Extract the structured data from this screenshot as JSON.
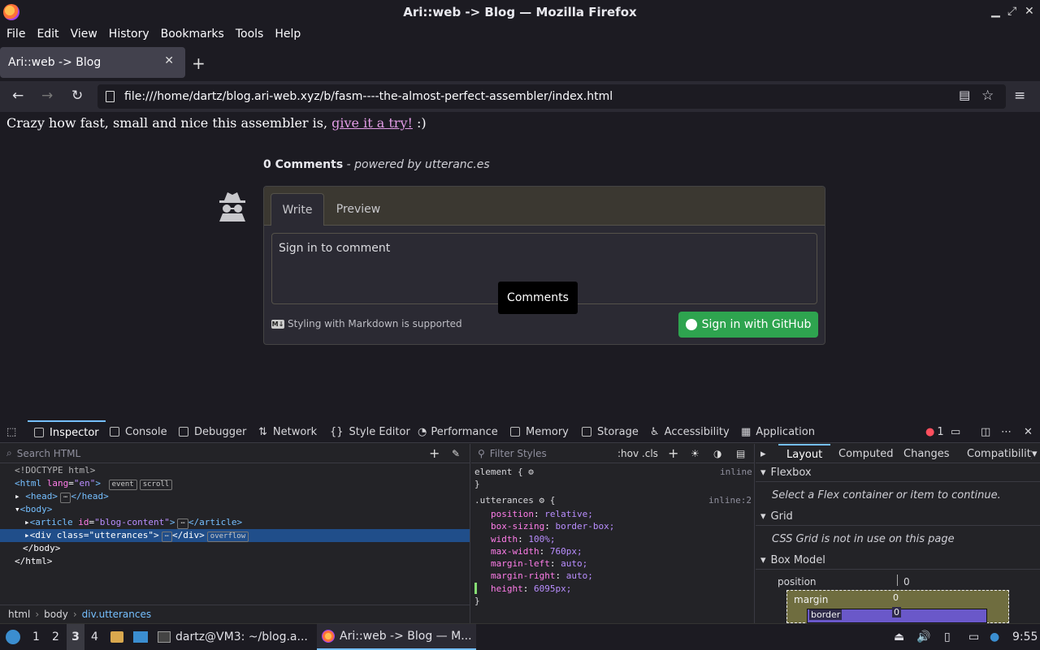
{
  "window": {
    "title": "Ari::web -> Blog — Mozilla Firefox"
  },
  "menubar": [
    "File",
    "Edit",
    "View",
    "History",
    "Bookmarks",
    "Tools",
    "Help"
  ],
  "tab": {
    "title": "Ari::web -> Blog"
  },
  "urlbar": {
    "url": "file:///home/dartz/blog.ari-web.xyz/b/fasm----the-almost-perfect-assembler/index.html"
  },
  "page": {
    "intro_text": "Crazy how fast, small and nice this assembler is,",
    "intro_link": "give it a try!",
    "intro_suffix": ":)",
    "comments_count": "0 Comments",
    "powered_by": "- powered by utteranc.es",
    "tabs": [
      "Write",
      "Preview"
    ],
    "textarea_text": "Sign in to comment",
    "markdown_note": "Styling with Markdown is supported",
    "markdown_icon": "M↓",
    "signin_button": "Sign in with GitHub",
    "tooltip": "Comments"
  },
  "devtools": {
    "tabs": [
      "Inspector",
      "Console",
      "Debugger",
      "Network",
      "Style Editor",
      "Performance",
      "Memory",
      "Storage",
      "Accessibility",
      "Application"
    ],
    "error_count": "1",
    "search_placeholder": "Search HTML",
    "filter_placeholder": "Filter Styles",
    "hov_cls": ":hov .cls",
    "tree": {
      "doctype": "<!DOCTYPE html>",
      "html_open": "<html",
      "html_attr": "lang",
      "html_val": "\"en\"",
      "pill_event": "event",
      "pill_scroll": "scroll",
      "head": "<head>",
      "head_close": "</head>",
      "body": "<body>",
      "article_open": "<article",
      "article_attr": "id",
      "article_val": "\"blog-content\"",
      "article_close": "</article>",
      "div_open": "<div",
      "div_attr": "class",
      "div_val": "\"utterances\"",
      "div_close": "</div>",
      "pill_overflow": "overflow",
      "body_close": "</body>",
      "html_close": "</html>"
    },
    "breadcrumbs": [
      "html",
      "body",
      "div.utterances"
    ],
    "rules": {
      "element_selector": "element {",
      "element_src": "inline",
      "close": "}",
      "utterances_selector": ".utterances",
      "utterances_src": "inline:2",
      "declarations": [
        {
          "prop": "position",
          "val": "relative;"
        },
        {
          "prop": "box-sizing",
          "val": "border-box;"
        },
        {
          "prop": "width",
          "val": "100%;"
        },
        {
          "prop": "max-width",
          "val": "760px;"
        },
        {
          "prop": "margin-left",
          "val": "auto;"
        },
        {
          "prop": "margin-right",
          "val": "auto;"
        },
        {
          "prop": "height",
          "val": "6095px;"
        }
      ]
    },
    "layout_tabs": [
      "Layout",
      "Computed",
      "Changes",
      "Compatibility"
    ],
    "sections": {
      "flexbox": "Flexbox",
      "flexbox_msg": "Select a Flex container or item to continue.",
      "grid": "Grid",
      "grid_msg": "CSS Grid is not in use on this page",
      "boxmodel": "Box Model"
    },
    "boxmodel": {
      "position_label": "position",
      "position_val": "0",
      "margin_label": "margin",
      "margin_val": "0",
      "border_label": "border",
      "border_val": "0"
    }
  },
  "taskbar": {
    "workspaces": [
      "1",
      "2",
      "3",
      "4"
    ],
    "active_workspace": "3",
    "terminal": "dartz@VM3: ~/blog.a...",
    "firefox": "Ari::web -> Blog — M...",
    "time": "9:55"
  }
}
